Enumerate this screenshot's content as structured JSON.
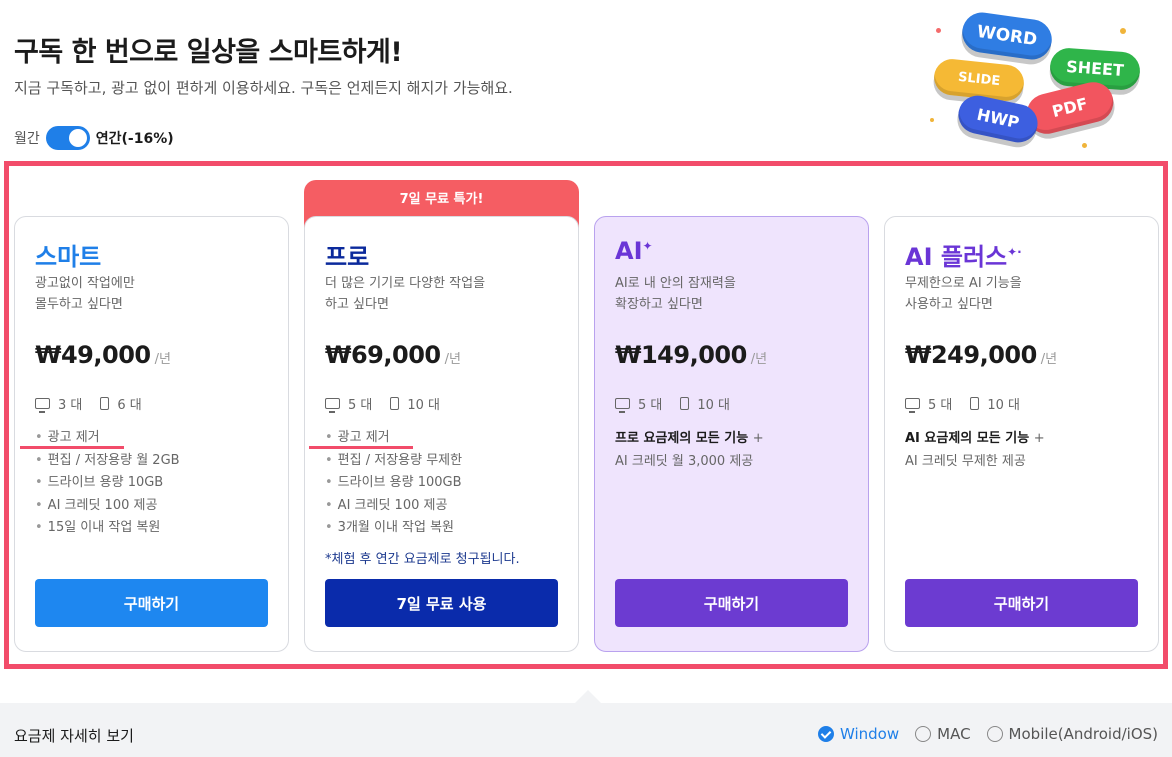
{
  "header": {
    "title": "구독 한 번으로 일상을 스마트하게!",
    "subtitle": "지금 구독하고, 광고 없이 편하게 이용하세요. 구독은 언제든지 해지가 가능해요.",
    "billing_toggle": {
      "monthly_label": "월간",
      "yearly_label": "연간(-16%)",
      "selected": "yearly"
    }
  },
  "art": {
    "pills": [
      "WORD",
      "SHEET",
      "SLIDE",
      "PDF",
      "HWP"
    ],
    "colors": {
      "word": "#2f7de3",
      "sheet": "#2fb54a",
      "slide": "#f5b935",
      "pdf": "#f2555f",
      "hwp": "#3d5fe0"
    }
  },
  "badge": {
    "label": "7일 무료 특가!"
  },
  "plans": [
    {
      "name": "스마트",
      "name_color": "#1f7fe8",
      "desc_line1": "광고없이 작업에만",
      "desc_line2": "몰두하고 싶다면",
      "price": "₩49,000",
      "unit": "/년",
      "desktops": "3 대",
      "mobiles": "6 대",
      "features": [
        "광고 제거",
        "편집 / 저장용량 월 2GB",
        "드라이브 용량 10GB",
        "AI 크레딧 100 제공",
        "15일 이내 작업 복원"
      ],
      "button": "구매하기",
      "button_color": "#1e87f0"
    },
    {
      "name": "프로",
      "name_color": "#0b2a9c",
      "desc_line1": "더 많은 기기로 다양한 작업을",
      "desc_line2": "하고 싶다면",
      "price": "₩69,000",
      "unit": "/년",
      "desktops": "5 대",
      "mobiles": "10 대",
      "features": [
        "광고 제거",
        "편집 / 저장용량 무제한",
        "드라이브 용량 100GB",
        "AI 크레딧 100 제공",
        "3개월 이내 작업 복원"
      ],
      "note": "*체험 후 연간 요금제로 청구됩니다.",
      "button": "7일 무료 사용",
      "button_color": "#0a2bab"
    },
    {
      "name": "AI",
      "name_color": "#6a35d6",
      "desc_line1": "AI로 내 안의 잠재력을",
      "desc_line2": "확장하고 싶다면",
      "price": "₩149,000",
      "unit": "/년",
      "desktops": "5 대",
      "mobiles": "10 대",
      "feature_bold": "프로 요금제의 모든 기능",
      "feature_plus": "+",
      "feature_text": "AI 크레딧 월 3,000 제공",
      "button": "구매하기",
      "button_color": "#6c3bd1"
    },
    {
      "name": "AI 플러스",
      "name_color": "#6a35d6",
      "desc_line1": "무제한으로 AI 기능을",
      "desc_line2": "사용하고 싶다면",
      "price": "₩249,000",
      "unit": "/년",
      "desktops": "5 대",
      "mobiles": "10 대",
      "feature_bold": "AI 요금제의 모든 기능",
      "feature_plus": "+",
      "feature_text": "AI 크레딧 무제한 제공",
      "button": "구매하기",
      "button_color": "#6c3bd1"
    }
  ],
  "details": {
    "title": "요금제 자세히 보기",
    "platforms": [
      "Window",
      "MAC",
      "Mobile(Android/iOS)"
    ],
    "selected_platform": "Window"
  }
}
